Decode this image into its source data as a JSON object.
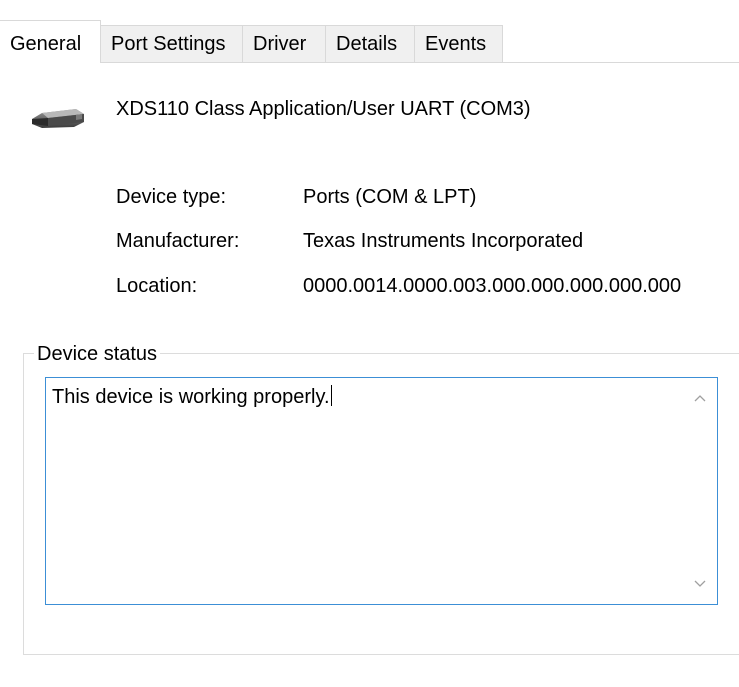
{
  "tabs": [
    {
      "label": "General",
      "active": true
    },
    {
      "label": "Port Settings",
      "active": false
    },
    {
      "label": "Driver",
      "active": false
    },
    {
      "label": "Details",
      "active": false
    },
    {
      "label": "Events",
      "active": false
    }
  ],
  "device": {
    "icon": "serial-port-connector-icon",
    "name": "XDS110 Class Application/User UART (COM3)"
  },
  "properties": {
    "device_type": {
      "label": "Device type:",
      "value": "Ports (COM & LPT)"
    },
    "manufacturer": {
      "label": "Manufacturer:",
      "value": "Texas Instruments Incorporated"
    },
    "location": {
      "label": "Location:",
      "value": "0000.0014.0000.003.000.000.000.000.000"
    }
  },
  "status": {
    "group_label": "Device status",
    "text": "This device is working properly."
  },
  "colors": {
    "focus_border": "#3c8fd6",
    "tab_inactive_bg": "#f0f0f0",
    "group_border": "#dcdcdc"
  }
}
